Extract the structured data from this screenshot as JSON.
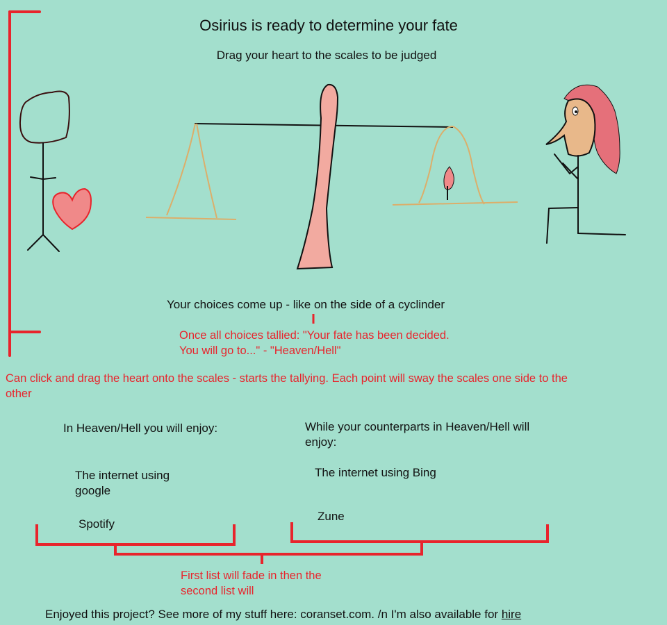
{
  "header": {
    "title": "Osirius is ready to determine your fate",
    "subtitle": "Drag your heart to the scales to be judged"
  },
  "main": {
    "choices_caption": "Your choices come up - like on the side of a cyclinder"
  },
  "notes": {
    "fate_note": "Once all choices tallied: \"Your fate has been decided. You will go to...\"  - \"Heaven/Hell\"",
    "drag_note": "Can click and drag the heart onto the scales - starts the tallying. Each point will sway the scales one side to the other",
    "fade_note": "First list will fade in then the second list will"
  },
  "lists": {
    "left": {
      "heading": "In Heaven/Hell you will enjoy:",
      "items": [
        "The internet using google",
        "Spotify"
      ]
    },
    "right": {
      "heading": "While your counterparts in Heaven/Hell will enjoy:",
      "items": [
        "The internet using Bing",
        "Zune"
      ]
    }
  },
  "footer": {
    "text": "Enjoyed this project? See more of my stuff here: coranset.com. /n I'm also available for ",
    "link_label": "hire"
  },
  "colors": {
    "background": "#a3dfcd",
    "annotation": "#e8242c",
    "heart": "#f08989",
    "pillar": "#f2aaa0",
    "scale_rope": "#dcae6a",
    "hair": "#e5707a",
    "face": "#e8b88a"
  }
}
